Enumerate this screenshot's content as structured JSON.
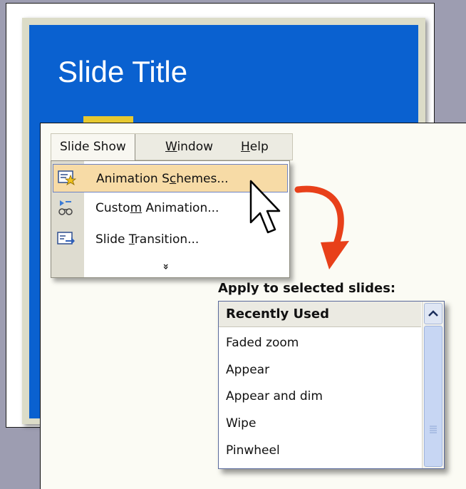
{
  "slide": {
    "title": "Slide Title"
  },
  "menu": {
    "tabs": [
      "Slide Show",
      "Window",
      "Help"
    ],
    "items": [
      {
        "prefix": "Animation S",
        "hot": "c",
        "suffix": "hemes...",
        "icon": "animation-schemes-icon",
        "highlighted": true
      },
      {
        "prefix": "Custo",
        "hot": "m",
        "suffix": " Animation...",
        "icon": "custom-animation-icon",
        "highlighted": false
      },
      {
        "prefix": "Slide ",
        "hot": "T",
        "suffix": "ransition...",
        "icon": "slide-transition-icon",
        "highlighted": false
      }
    ],
    "expand": "»"
  },
  "apply_panel": {
    "label": "Apply to selected slides:",
    "header": "Recently Used",
    "items": [
      "Faded zoom",
      "Appear",
      "Appear and dim",
      "Wipe",
      "Pinwheel"
    ]
  },
  "colors": {
    "background": "#9d9db1",
    "slide_blue": "#0a61d0",
    "highlight": "#f7dba6",
    "arrow": "#e8401a"
  }
}
